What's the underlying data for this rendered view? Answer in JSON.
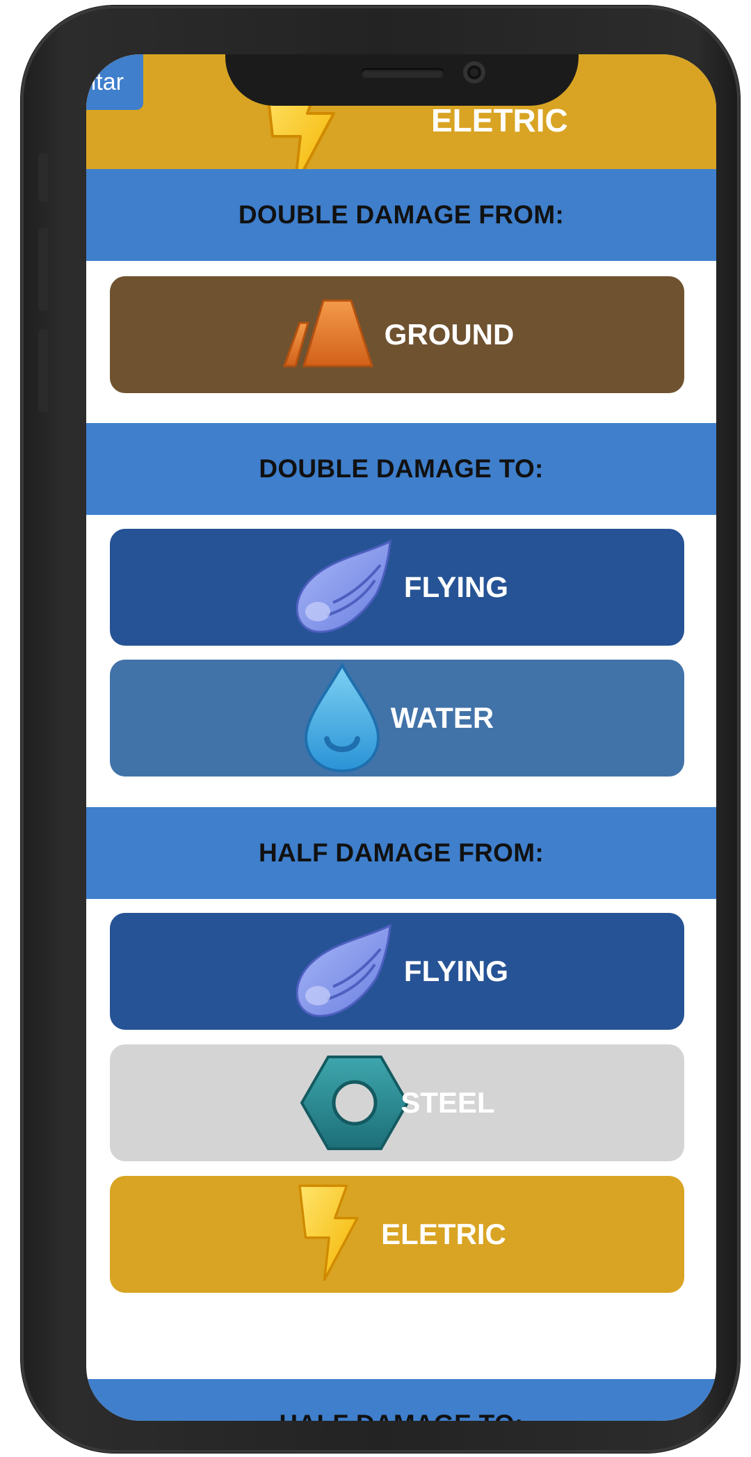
{
  "header": {
    "title": "ELETRIC",
    "back_label": "Voltar",
    "color": "#d9a423",
    "icon": "lightning-bolt-icon"
  },
  "sections": [
    {
      "title": "DOUBLE DAMAGE FROM:",
      "types": [
        {
          "label": "GROUND",
          "color": "#6f5230",
          "icon": "ground-icon"
        }
      ]
    },
    {
      "title": "DOUBLE DAMAGE TO:",
      "types": [
        {
          "label": "FLYING",
          "color": "#265395",
          "icon": "wing-icon"
        },
        {
          "label": "WATER",
          "color": "#4173a9",
          "icon": "water-drop-icon"
        }
      ]
    },
    {
      "title": "HALF DAMAGE FROM:",
      "types": [
        {
          "label": "FLYING",
          "color": "#265395",
          "icon": "wing-icon"
        },
        {
          "label": "STEEL",
          "color": "#d4d4d4",
          "icon": "steel-nut-icon"
        },
        {
          "label": "ELETRIC",
          "color": "#d9a423",
          "icon": "lightning-bolt-icon"
        }
      ]
    },
    {
      "title": "HALF DAMAGE TO:",
      "types": []
    }
  ],
  "colors": {
    "section_header": "#3f7fcc",
    "card_text": "#ffffff"
  }
}
